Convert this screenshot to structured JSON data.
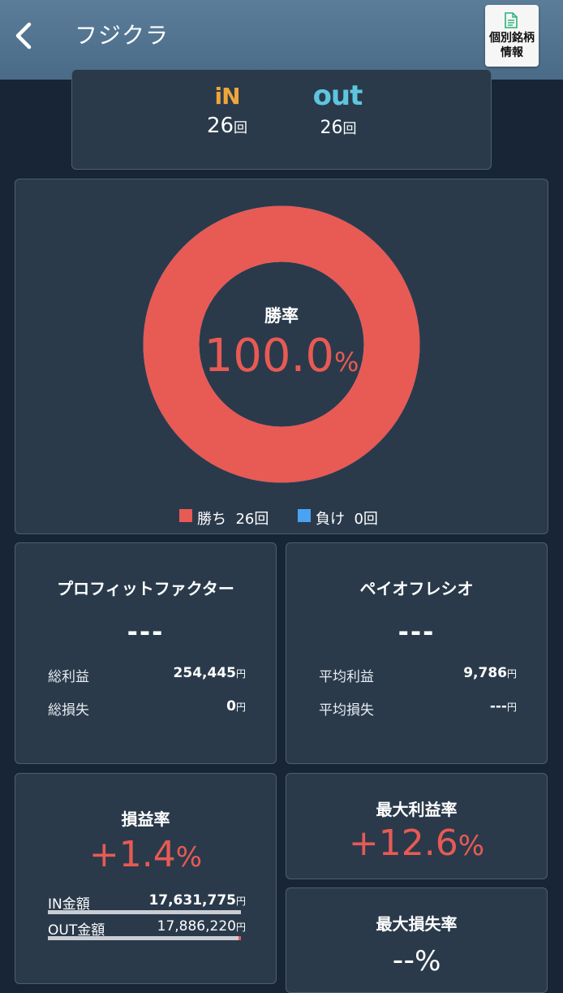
{
  "header": {
    "title": "フジクラ",
    "back_icon": "chevron-left-icon",
    "info_button_line1": "個別銘柄",
    "info_button_line2": "情報",
    "info_button_icon": "document-icon"
  },
  "trades": {
    "in_label": "iN",
    "in_count": "26",
    "out_label": "out",
    "out_count": "26",
    "unit": "回",
    "in_color": "#f0a53a",
    "out_color": "#5dc6dd"
  },
  "win_rate": {
    "label": "勝率",
    "value": "100.0",
    "unit": "%",
    "win_fraction": 1.0,
    "legend": [
      {
        "label": "勝ち",
        "count": "26回",
        "color": "#e85a54"
      },
      {
        "label": "負け",
        "count": "0回",
        "color": "#4aa3f2"
      }
    ]
  },
  "profit_factor": {
    "title": "プロフィットファクター",
    "value": "---",
    "rows": [
      {
        "label": "総利益",
        "value": "254,445",
        "unit": "円"
      },
      {
        "label": "総損失",
        "value": "0",
        "unit": "円"
      }
    ]
  },
  "payoff_ratio": {
    "title": "ペイオフレシオ",
    "value": "---",
    "rows": [
      {
        "label": "平均利益",
        "value": "9,786",
        "unit": "円"
      },
      {
        "label": "平均損失",
        "value": "---",
        "unit": "円"
      }
    ]
  },
  "pl_rate": {
    "title": "損益率",
    "value": "+1.4",
    "unit": "%",
    "rows": [
      {
        "label": "IN金額",
        "value": "17,631,775",
        "unit": "円"
      },
      {
        "label": "OUT金額",
        "value": "17,886,220",
        "unit": "円"
      }
    ]
  },
  "max_profit": {
    "title": "最大利益率",
    "value": "+12.6",
    "unit": "%"
  },
  "max_loss": {
    "title": "最大損失率",
    "value": "--",
    "unit": "%"
  },
  "colors": {
    "positive": "#e85a54",
    "card": "#2a3a4b",
    "background": "#172537"
  }
}
